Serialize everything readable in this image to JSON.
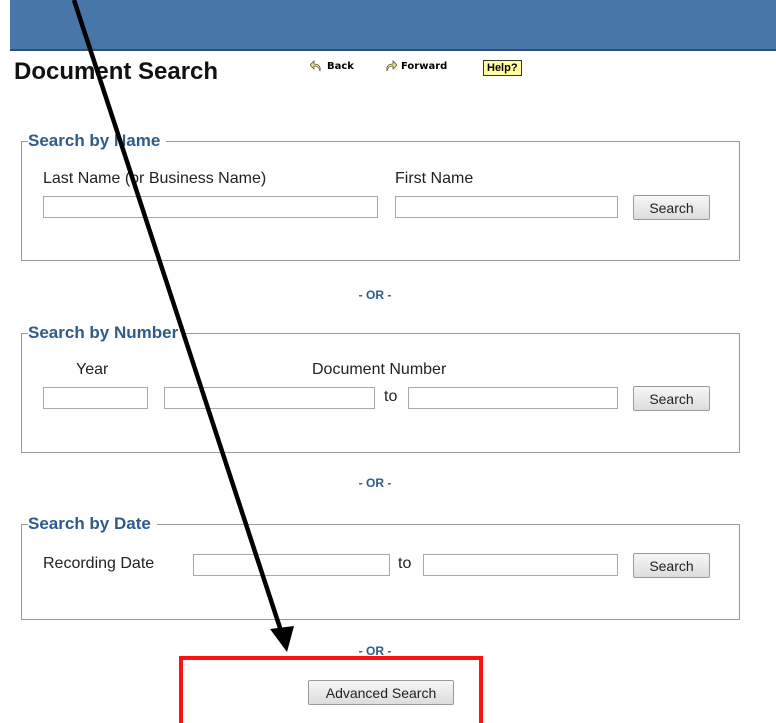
{
  "header": {
    "title": "Document Search",
    "back_label": "Back",
    "forward_label": "Forward",
    "help_label": "Help?"
  },
  "by_name": {
    "legend": "Search by Name",
    "last_name_label": "Last Name (or Business Name)",
    "first_name_label": "First Name",
    "last_name_value": "",
    "first_name_value": "",
    "search_label": "Search"
  },
  "or_label": "- OR -",
  "by_number": {
    "legend": "Search by Number",
    "year_label": "Year",
    "doc_number_label": "Document Number",
    "to_label": "to",
    "search_label": "Search"
  },
  "by_date": {
    "legend": "Search by Date",
    "recording_date_label": "Recording Date",
    "to_label": "to",
    "search_label": "Search"
  },
  "advanced_search_label": "Advanced Search",
  "colors": {
    "header_bar": "#4876a8",
    "legend_text": "#2f5b8c",
    "highlight": "#ff1010",
    "arrow": "#000000"
  }
}
